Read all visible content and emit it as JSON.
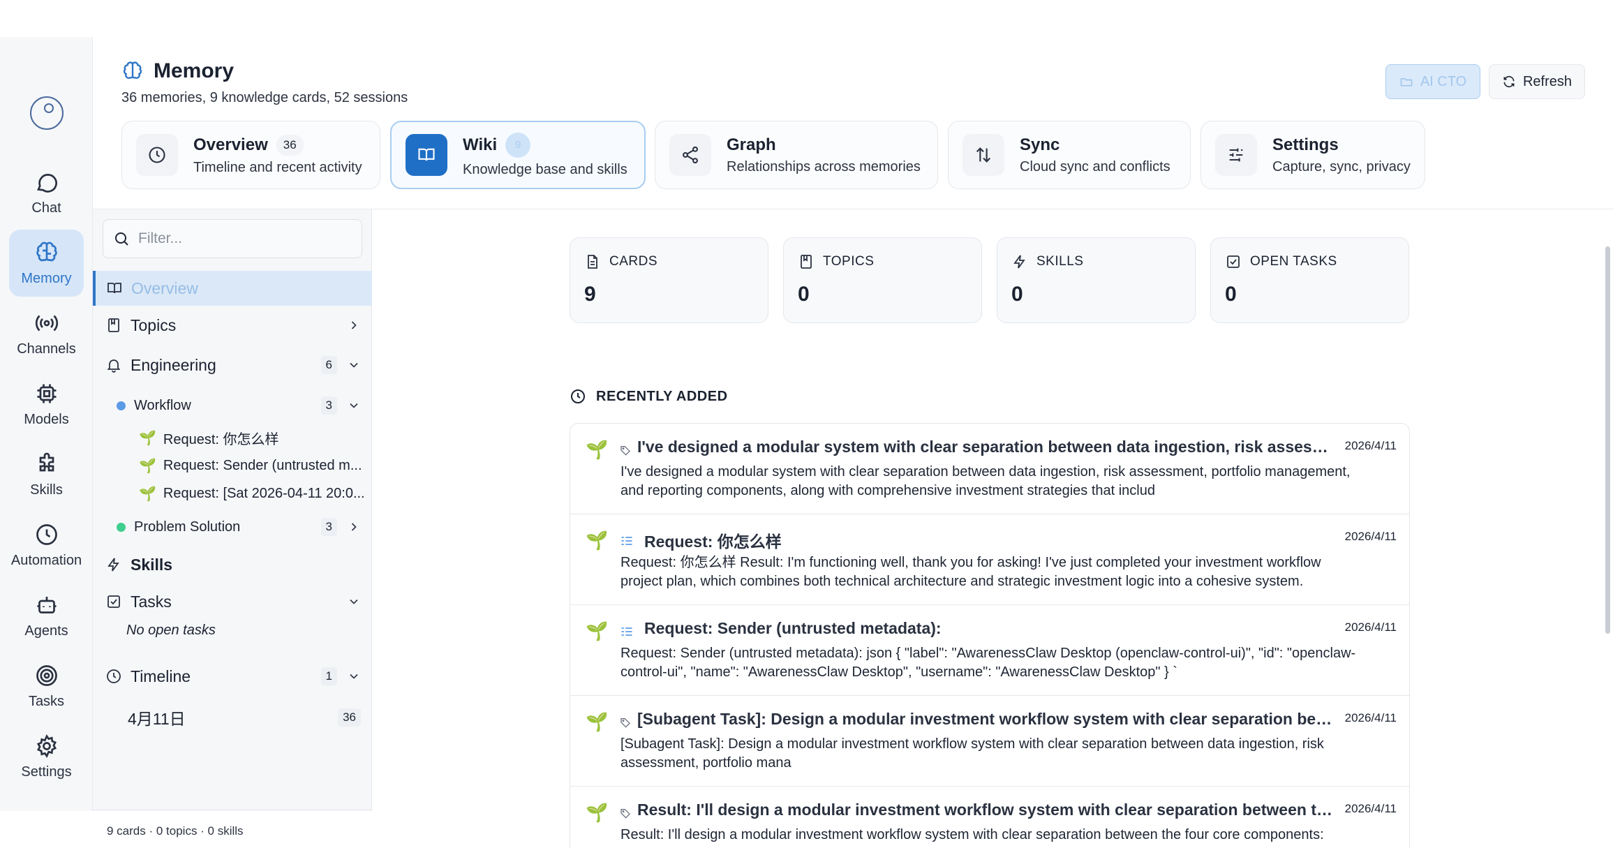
{
  "rail": {
    "items": [
      {
        "label": "Chat",
        "icon": "chat-bubble-icon"
      },
      {
        "label": "Memory",
        "icon": "brain-icon"
      },
      {
        "label": "Channels",
        "icon": "broadcast-icon"
      },
      {
        "label": "Models",
        "icon": "cpu-chip-icon"
      },
      {
        "label": "Skills",
        "icon": "puzzle-icon"
      },
      {
        "label": "Automation",
        "icon": "clock-icon"
      },
      {
        "label": "Agents",
        "icon": "robot-icon"
      },
      {
        "label": "Tasks",
        "icon": "target-icon"
      },
      {
        "label": "Settings",
        "icon": "gear-icon"
      }
    ]
  },
  "header": {
    "title": "Memory",
    "subtitle": "36 memories, 9 knowledge cards, 52 sessions",
    "ai_cto_label": "AI CTO",
    "refresh_label": "Refresh"
  },
  "tabs": [
    {
      "title": "Overview",
      "badge": "36",
      "desc": "Timeline and recent activity",
      "icon": "clock-icon"
    },
    {
      "title": "Wiki",
      "badge": "9",
      "desc": "Knowledge base and skills",
      "icon": "book-icon"
    },
    {
      "title": "Graph",
      "desc": "Relationships across memories",
      "icon": "share-icon"
    },
    {
      "title": "Sync",
      "desc": "Cloud sync and conflicts",
      "icon": "arrows-updown-icon"
    },
    {
      "title": "Settings",
      "desc": "Capture, sync, privacy",
      "icon": "sliders-icon"
    }
  ],
  "tree": {
    "filter_placeholder": "Filter...",
    "overview": "Overview",
    "topics": "Topics",
    "engineering": {
      "label": "Engineering",
      "count": "6"
    },
    "workflow": {
      "label": "Workflow",
      "count": "3",
      "color": "#5b9be6"
    },
    "requests": [
      "Request: 你怎么样",
      "Request: Sender (untrusted m...",
      "Request: [Sat 2026-04-11 20:0..."
    ],
    "problem_solution": {
      "label": "Problem Solution",
      "count": "3",
      "color": "#3ecf8e"
    },
    "skills": "Skills",
    "tasks": "Tasks",
    "no_tasks": "No open tasks",
    "timeline": {
      "label": "Timeline",
      "count": "1"
    },
    "date_group": {
      "label": "4月11日",
      "count": "36"
    },
    "footer": "9 cards · 0 topics · 0 skills"
  },
  "stats": [
    {
      "label": "CARDS",
      "value": "9",
      "icon": "document-icon"
    },
    {
      "label": "TOPICS",
      "value": "0",
      "icon": "bookmark-book-icon"
    },
    {
      "label": "SKILLS",
      "value": "0",
      "icon": "lightning-icon"
    },
    {
      "label": "OPEN TASKS",
      "value": "0",
      "icon": "checkbox-icon"
    }
  ],
  "recent": {
    "heading": "RECENTLY ADDED",
    "items": [
      {
        "title": "I've designed a modular system with clear separation between data ingestion, risk assessm...",
        "date": "2026/4/11",
        "body": "I've designed a modular system with clear separation between data ingestion, risk assessment, portfolio management, and reporting components, along with comprehensive investment strategies that includ",
        "icon": "tag-icon"
      },
      {
        "title": "Request: 你怎么样",
        "date": "2026/4/11",
        "body": "Request: 你怎么样 Result: I'm functioning well, thank you for asking! I've just completed your investment workflow project plan, which combines both technical architecture and strategic investment logic into a cohesive system.",
        "icon": "list-icon"
      },
      {
        "title": "Request: Sender (untrusted metadata):",
        "date": "2026/4/11",
        "body": "Request: Sender (untrusted metadata): json { \"label\": \"AwarenessClaw Desktop (openclaw-control-ui)\", \"id\": \"openclaw-control-ui\", \"name\": \"AwarenessClaw Desktop\", \"username\": \"AwarenessClaw Desktop\" } `",
        "icon": "list-icon"
      },
      {
        "title": "[Subagent Task]: Design a modular investment workflow system with clear separation betw...",
        "date": "2026/4/11",
        "body": "[Subagent Task]: Design a modular investment workflow system with clear separation between data ingestion, risk assessment, portfolio mana",
        "icon": "tag-icon"
      },
      {
        "title": "Result: I'll design a modular investment workflow system with clear separation between the f...",
        "date": "2026/4/11",
        "body": "Result: I'll design a modular investment workflow system with clear separation between the four core components:",
        "icon": "tag-icon"
      }
    ]
  },
  "colors": {
    "accent": "#2f76c7",
    "active_bg": "#d6e6f8"
  }
}
